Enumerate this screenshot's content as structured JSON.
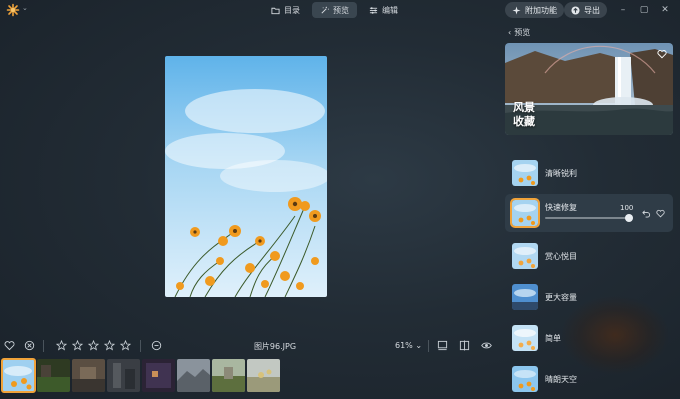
{
  "toolbar": {
    "tabs": [
      {
        "label": "目录",
        "icon": "folder-icon",
        "active": false
      },
      {
        "label": "预览",
        "icon": "magic-wand-icon",
        "active": true
      },
      {
        "label": "编辑",
        "icon": "sliders-icon",
        "active": false
      }
    ],
    "add_feature_label": "附加功能",
    "export_label": "导出"
  },
  "bottombar": {
    "filename": "图片96.JPG",
    "zoom": "61%"
  },
  "filmstrip": {
    "count": 8,
    "active_index": 0
  },
  "panel": {
    "back_label": "预览",
    "hero_title_line1": "风景",
    "hero_title_line2": "收藏",
    "items": [
      {
        "label": "清晰锐利",
        "active": false
      },
      {
        "label": "快速修复",
        "active": true,
        "value": "100"
      },
      {
        "label": "赏心悦目",
        "active": false
      },
      {
        "label": "更大容量",
        "active": false
      },
      {
        "label": "简单",
        "active": false
      },
      {
        "label": "晴朗天空",
        "active": false
      }
    ]
  },
  "colors": {
    "accent": "#f0a33a",
    "background": "#222c35",
    "panel_active": "#2f3c47"
  }
}
